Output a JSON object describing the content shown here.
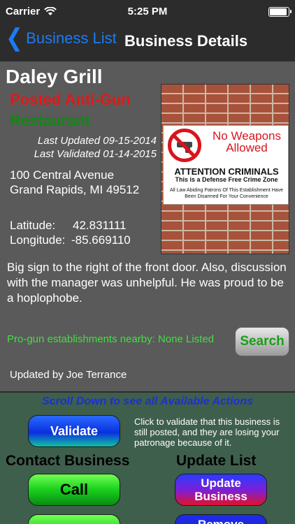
{
  "status_bar": {
    "carrier": "Carrier",
    "time": "5:25 PM",
    "battery_level": 0.95
  },
  "nav": {
    "back_label": "Business List",
    "title": "Business Details"
  },
  "business": {
    "name": "Daley Grill",
    "status_line1": "Posted Anti-Gun",
    "status_line2": "Restaurant",
    "last_updated": "Last Updated 09-15-2014",
    "last_validated": "Last Validated 01-14-2015",
    "address_line1": "100 Central Avenue",
    "address_line2": "Grand Rapids, MI 49512",
    "latitude_label": "Latitude:",
    "latitude_value": "42.831111",
    "longitude_label": "Longitude:",
    "longitude_value": "-85.669110",
    "description": "Big sign to the right of the front door.  Also, discussion with the manager was unhelpful.  He was proud to be a hoplophobe.",
    "nearby_text": "Pro-gun establishments nearby: None Listed",
    "search_label": "Search",
    "updated_by": "Updated by Joe Terrance"
  },
  "sign_image": {
    "headline": "No Weapons Allowed",
    "attention": "ATTENTION CRIMINALS",
    "subline": "This is a Defense Free Crime Zone",
    "fine_print": "All Law Abiding Patrons Of This Establishment Have Been Disarmed For Your Convenience"
  },
  "actions": {
    "scroll_hint": "Scroll Down to see all Available Actions",
    "validate_label": "Validate",
    "validate_help": "Click to validate that this business is still posted, and they are losing your patronage because of it.",
    "contact_heading": "Contact Business",
    "update_heading": "Update List",
    "call_label": "Call",
    "update_business_label": "Update Business",
    "remove_label": "Remove"
  },
  "colors": {
    "accent_blue": "#1a7cf5",
    "status_red": "#e31818",
    "status_green": "#118811",
    "nearby_green": "#44dd44",
    "panel_top": "#5a5a5a",
    "panel_bottom": "#3f5f4d"
  },
  "icons": {
    "back": "chevron-left-icon",
    "wifi": "wifi-icon",
    "battery": "battery-icon"
  }
}
